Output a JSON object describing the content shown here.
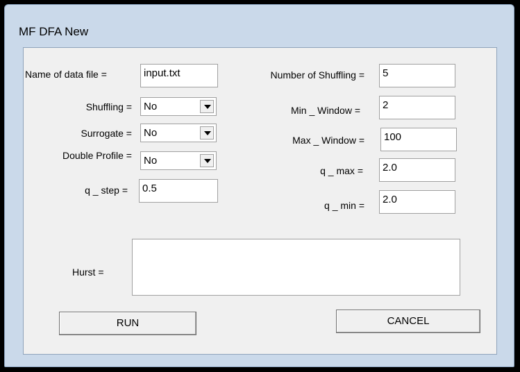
{
  "window": {
    "title": "MF DFA New"
  },
  "fields": {
    "data_file_label": "Name of data file =",
    "data_file_value": "input.txt",
    "shuffling_label": "Shuffling =",
    "shuffling_value": "No",
    "surrogate_label": "Surrogate =",
    "surrogate_value": "No",
    "double_profile_label": "Double Profile =",
    "double_profile_value": "No",
    "q_step_label": "q _ step =",
    "q_step_value": "0.5",
    "num_shuffling_label": "Number of Shuffling =",
    "num_shuffling_value": "5",
    "min_window_label": "Min _ Window =",
    "min_window_value": "2",
    "max_window_label": "Max _ Window =",
    "max_window_value": "100",
    "q_max_label": "q _ max =",
    "q_max_value": "2.0",
    "q_min_label": "q _ min =",
    "q_min_value": "2.0",
    "hurst_label": "Hurst =",
    "hurst_value": ""
  },
  "buttons": {
    "run": "RUN",
    "cancel": "CANCEL"
  }
}
